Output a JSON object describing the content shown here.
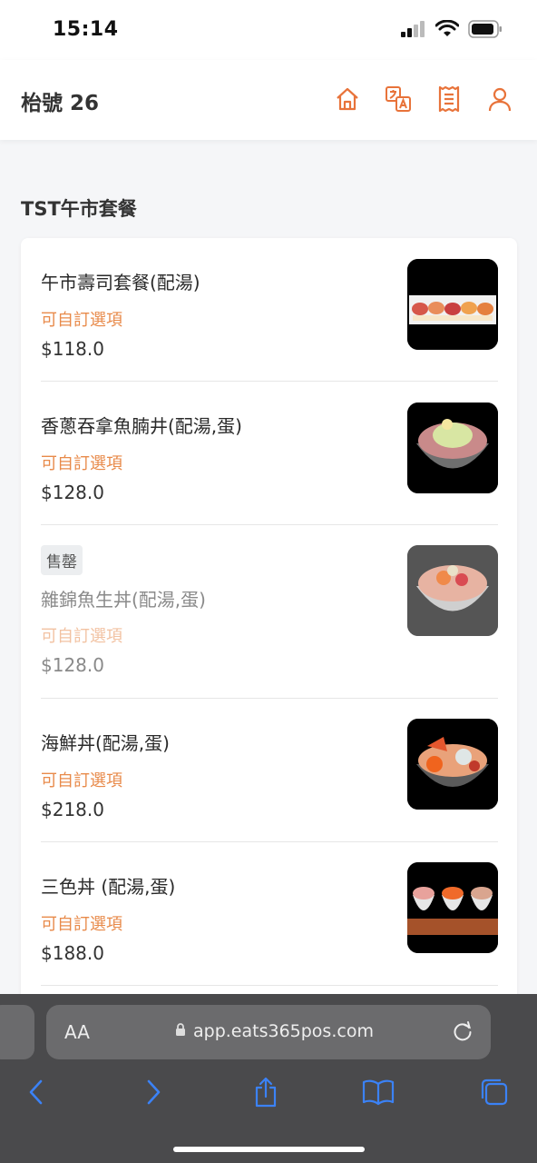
{
  "status": {
    "time": "15:14"
  },
  "header": {
    "table_label": "枱號 26",
    "icons": [
      "home-icon",
      "translate-icon",
      "receipt-icon",
      "user-icon"
    ]
  },
  "section": {
    "title": "TST午市套餐"
  },
  "items": [
    {
      "name": "午市壽司套餐(配湯)",
      "option": "可自訂選項",
      "price": "$118.0",
      "sold_out": false
    },
    {
      "name": "香蔥吞拿魚腩井(配湯,蛋)",
      "option": "可自訂選項",
      "price": "$128.0",
      "sold_out": false
    },
    {
      "badge": "售罄",
      "name": "雜錦魚生丼(配湯,蛋)",
      "option": "可自訂選項",
      "price": "$128.0",
      "sold_out": true
    },
    {
      "name": "海鮮丼(配湯,蛋)",
      "option": "可自訂選項",
      "price": "$218.0",
      "sold_out": false
    },
    {
      "name": "三色丼 (配湯,蛋)",
      "option": "可自訂選項",
      "price": "$188.0",
      "sold_out": false
    }
  ],
  "browser": {
    "aa": "AA",
    "url": "app.eats365pos.com"
  },
  "colors": {
    "accent": "#e8733a",
    "option_text": "#e88a4a",
    "safari_bar": "#4a4a4c",
    "safari_blue": "#3b82f6"
  }
}
